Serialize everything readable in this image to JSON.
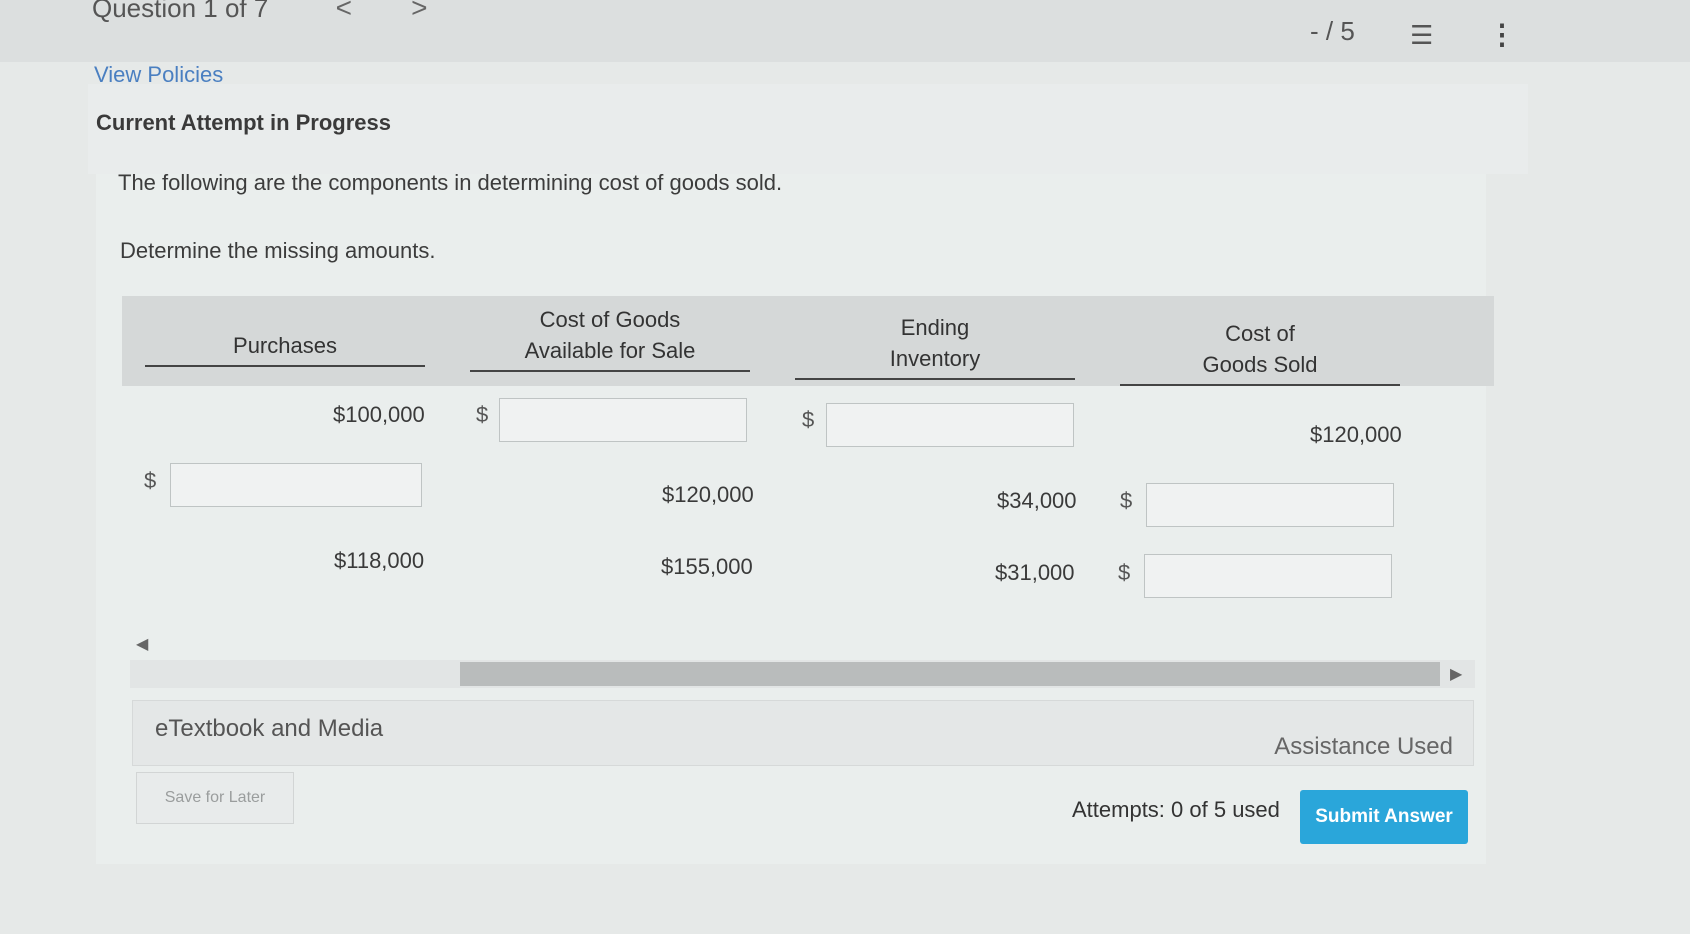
{
  "nav": {
    "question_label": "Question 1 of 7",
    "prev": "<",
    "next": ">",
    "score": "- / 5"
  },
  "policies": "View Policies",
  "attempt_title": "Current Attempt in Progress",
  "question": {
    "line1": "The following are the components in determining cost of goods sold.",
    "line2": "Determine the missing amounts."
  },
  "table": {
    "headers": {
      "purchases": "Purchases",
      "cogas_1": "Cost of Goods",
      "cogas_2": "Available for Sale",
      "ending_1": "Ending",
      "ending_2": "Inventory",
      "cogs_1": "Cost of",
      "cogs_2": "Goods Sold"
    },
    "currency": "$",
    "rows": [
      {
        "purchases": "$100,000",
        "cogas": "",
        "ending": "",
        "cogs": "$120,000"
      },
      {
        "purchases": "",
        "cogas": "$120,000",
        "ending": "$34,000",
        "cogs": ""
      },
      {
        "purchases": "$118,000",
        "cogas": "$155,000",
        "ending": "$31,000",
        "cogs": ""
      }
    ]
  },
  "etextbook": "eTextbook and Media",
  "assistance": "Assistance Used",
  "save_label": "Save for Later",
  "attempts": "Attempts: 0 of 5 used",
  "submit_label": "Submit Answer",
  "colors": {
    "accent": "#2aa6da",
    "link": "#4a7fc1"
  }
}
